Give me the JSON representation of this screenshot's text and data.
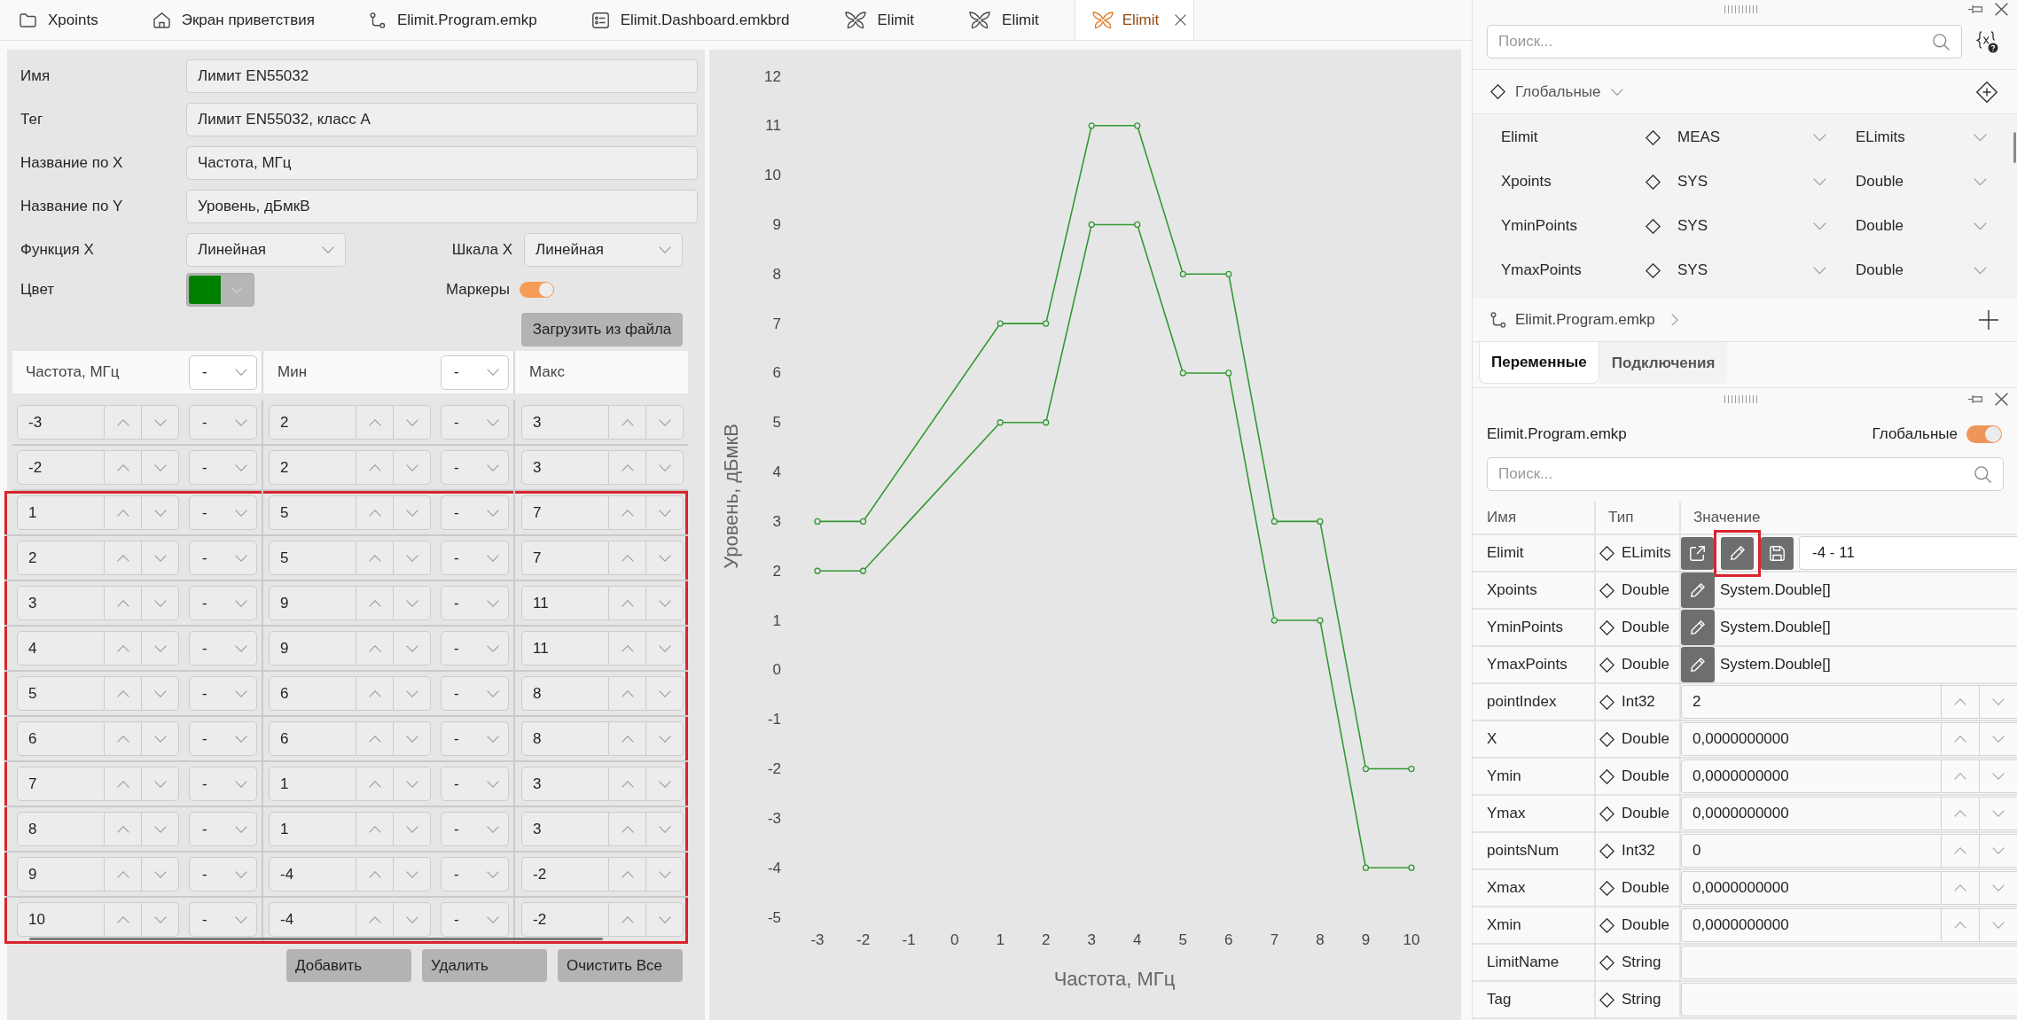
{
  "tabs": [
    {
      "kind": "sheet",
      "label": "Xpoints",
      "selected": false
    },
    {
      "kind": "home",
      "label": "Экран приветствия",
      "selected": false
    },
    {
      "kind": "program",
      "label": "Elimit.Program.emkp",
      "selected": false
    },
    {
      "kind": "dashboard",
      "label": "Elimit.Dashboard.emkbrd",
      "selected": false
    },
    {
      "kind": "limit",
      "label": "Elimit",
      "selected": false
    },
    {
      "kind": "limit",
      "label": "Elimit",
      "selected": false
    },
    {
      "kind": "limit",
      "label": "Elimit",
      "selected": true
    }
  ],
  "limit_form": {
    "fields": [
      {
        "label": "Имя",
        "value": "Лимит EN55032"
      },
      {
        "label": "Тег",
        "value": "Лимит EN55032, класс A"
      },
      {
        "label": "Название по X",
        "value": "Частота, МГц"
      },
      {
        "label": "Название по Y",
        "value": "Уровень, дБмкВ"
      }
    ],
    "x_function": {
      "label": "Функция X",
      "value": "Линейная"
    },
    "x_scale": {
      "label": "Шкала X",
      "value": "Линейная"
    },
    "color": {
      "label": "Цвет",
      "color": "#008000"
    },
    "markers": {
      "label": "Маркеры",
      "on": true
    },
    "load_button": "Загрузить из файла"
  },
  "points_table": {
    "columns": [
      {
        "label": "Частота, МГц",
        "unit": "-"
      },
      {
        "label": "Мин",
        "unit": "-"
      },
      {
        "label": "Макс"
      }
    ],
    "rows": [
      {
        "highlighted": false,
        "cells": [
          {
            "value": "-3",
            "unit": "-"
          },
          {
            "value": "2",
            "unit": "-"
          },
          {
            "value": "3"
          }
        ]
      },
      {
        "highlighted": false,
        "cells": [
          {
            "value": "-2",
            "unit": "-"
          },
          {
            "value": "2",
            "unit": "-"
          },
          {
            "value": "3"
          }
        ]
      },
      {
        "highlighted": true,
        "cells": [
          {
            "value": "1",
            "unit": "-"
          },
          {
            "value": "5",
            "unit": "-"
          },
          {
            "value": "7"
          }
        ]
      },
      {
        "highlighted": true,
        "cells": [
          {
            "value": "2",
            "unit": "-"
          },
          {
            "value": "5",
            "unit": "-"
          },
          {
            "value": "7"
          }
        ]
      },
      {
        "highlighted": true,
        "cells": [
          {
            "value": "3",
            "unit": "-"
          },
          {
            "value": "9",
            "unit": "-"
          },
          {
            "value": "11"
          }
        ]
      },
      {
        "highlighted": true,
        "cells": [
          {
            "value": "4",
            "unit": "-"
          },
          {
            "value": "9",
            "unit": "-"
          },
          {
            "value": "11"
          }
        ]
      },
      {
        "highlighted": true,
        "cells": [
          {
            "value": "5",
            "unit": "-"
          },
          {
            "value": "6",
            "unit": "-"
          },
          {
            "value": "8"
          }
        ]
      },
      {
        "highlighted": true,
        "cells": [
          {
            "value": "6",
            "unit": "-"
          },
          {
            "value": "6",
            "unit": "-"
          },
          {
            "value": "8"
          }
        ]
      },
      {
        "highlighted": true,
        "cells": [
          {
            "value": "7",
            "unit": "-"
          },
          {
            "value": "1",
            "unit": "-"
          },
          {
            "value": "3"
          }
        ]
      },
      {
        "highlighted": true,
        "cells": [
          {
            "value": "8",
            "unit": "-"
          },
          {
            "value": "1",
            "unit": "-"
          },
          {
            "value": "3"
          }
        ]
      },
      {
        "highlighted": true,
        "cells": [
          {
            "value": "9",
            "unit": "-"
          },
          {
            "value": "-4",
            "unit": "-"
          },
          {
            "value": "-2"
          }
        ]
      },
      {
        "highlighted": true,
        "cells": [
          {
            "value": "10",
            "unit": "-"
          },
          {
            "value": "-4",
            "unit": "-"
          },
          {
            "value": "-2"
          }
        ]
      }
    ],
    "buttons": [
      "Добавить",
      "Удалить",
      "Очистить Все"
    ]
  },
  "chart": {
    "chart_data": {
      "type": "line",
      "xlabel": "Частота, МГц",
      "ylabel": "Уровень, дБмкВ",
      "x": [
        -3,
        -2,
        1,
        2,
        3,
        4,
        5,
        6,
        7,
        8,
        9,
        10
      ],
      "series": [
        {
          "color": "#339933",
          "marker": "circle",
          "values": [
            2,
            2,
            5,
            5,
            9,
            9,
            6,
            6,
            1,
            1,
            -4,
            -4
          ]
        },
        {
          "color": "#339933",
          "marker": "circle",
          "values": [
            3,
            3,
            7,
            7,
            11,
            11,
            8,
            8,
            3,
            3,
            -2,
            -2
          ]
        }
      ],
      "xlim": [
        -3,
        10
      ],
      "ylim": [
        -5,
        12
      ],
      "xticks": [
        -3,
        -2,
        -1,
        0,
        1,
        2,
        3,
        4,
        5,
        6,
        7,
        8,
        9,
        10
      ],
      "yticks": [
        -5,
        -4,
        -3,
        -2,
        -1,
        0,
        1,
        2,
        3,
        4,
        5,
        6,
        7,
        8,
        9,
        10,
        11,
        12
      ]
    }
  },
  "inspector": {
    "search": {
      "placeholder": "Поиск..."
    },
    "scope": "Глобальные",
    "globals": [
      {
        "name": "Elimit",
        "category": "MEAS",
        "type": "ELimits"
      },
      {
        "name": "Xpoints",
        "category": "SYS",
        "type": "Double"
      },
      {
        "name": "YminPoints",
        "category": "SYS",
        "type": "Double"
      },
      {
        "name": "YmaxPoints",
        "category": "SYS",
        "type": "Double"
      }
    ],
    "program": "Elimit.Program.emkp",
    "tabs": [
      {
        "label": "Переменные",
        "selected": true
      },
      {
        "label": "Подключения",
        "selected": false
      }
    ]
  },
  "variables": {
    "title": "Elimit.Program.emkp",
    "globals_toggle": {
      "label": "Глобальные",
      "on": true
    },
    "search": {
      "placeholder": "Поиск..."
    },
    "columns": [
      "Имя",
      "Тип",
      "Значение"
    ],
    "rows": [
      {
        "name": "Elimit",
        "type": "ELimits",
        "kind": "object",
        "actions": [
          {
            "kind": "open",
            "highlighted": false
          },
          {
            "kind": "edit",
            "highlighted": true
          },
          {
            "kind": "save",
            "highlighted": false
          }
        ],
        "value": "-4 - 11"
      },
      {
        "name": "Xpoints",
        "type": "Double",
        "kind": "array",
        "actions": [
          {
            "kind": "edit",
            "highlighted": false
          }
        ],
        "value": "System.Double[]"
      },
      {
        "name": "YminPoints",
        "type": "Double",
        "kind": "array",
        "actions": [
          {
            "kind": "edit",
            "highlighted": false
          }
        ],
        "value": "System.Double[]"
      },
      {
        "name": "YmaxPoints",
        "type": "Double",
        "kind": "array",
        "actions": [
          {
            "kind": "edit",
            "highlighted": false
          }
        ],
        "value": "System.Double[]"
      },
      {
        "name": "pointIndex",
        "type": "Int32",
        "kind": "number",
        "value": "2"
      },
      {
        "name": "X",
        "type": "Double",
        "kind": "number",
        "value": "0,0000000000"
      },
      {
        "name": "Ymin",
        "type": "Double",
        "kind": "number",
        "value": "0,0000000000"
      },
      {
        "name": "Ymax",
        "type": "Double",
        "kind": "number",
        "value": "0,0000000000"
      },
      {
        "name": "pointsNum",
        "type": "Int32",
        "kind": "number",
        "value": "0"
      },
      {
        "name": "Xmax",
        "type": "Double",
        "kind": "number",
        "value": "0,0000000000"
      },
      {
        "name": "Xmin",
        "type": "Double",
        "kind": "number",
        "value": "0,0000000000"
      },
      {
        "name": "LimitName",
        "type": "String",
        "kind": "text"
      },
      {
        "name": "Tag",
        "type": "String",
        "kind": "text"
      }
    ]
  }
}
